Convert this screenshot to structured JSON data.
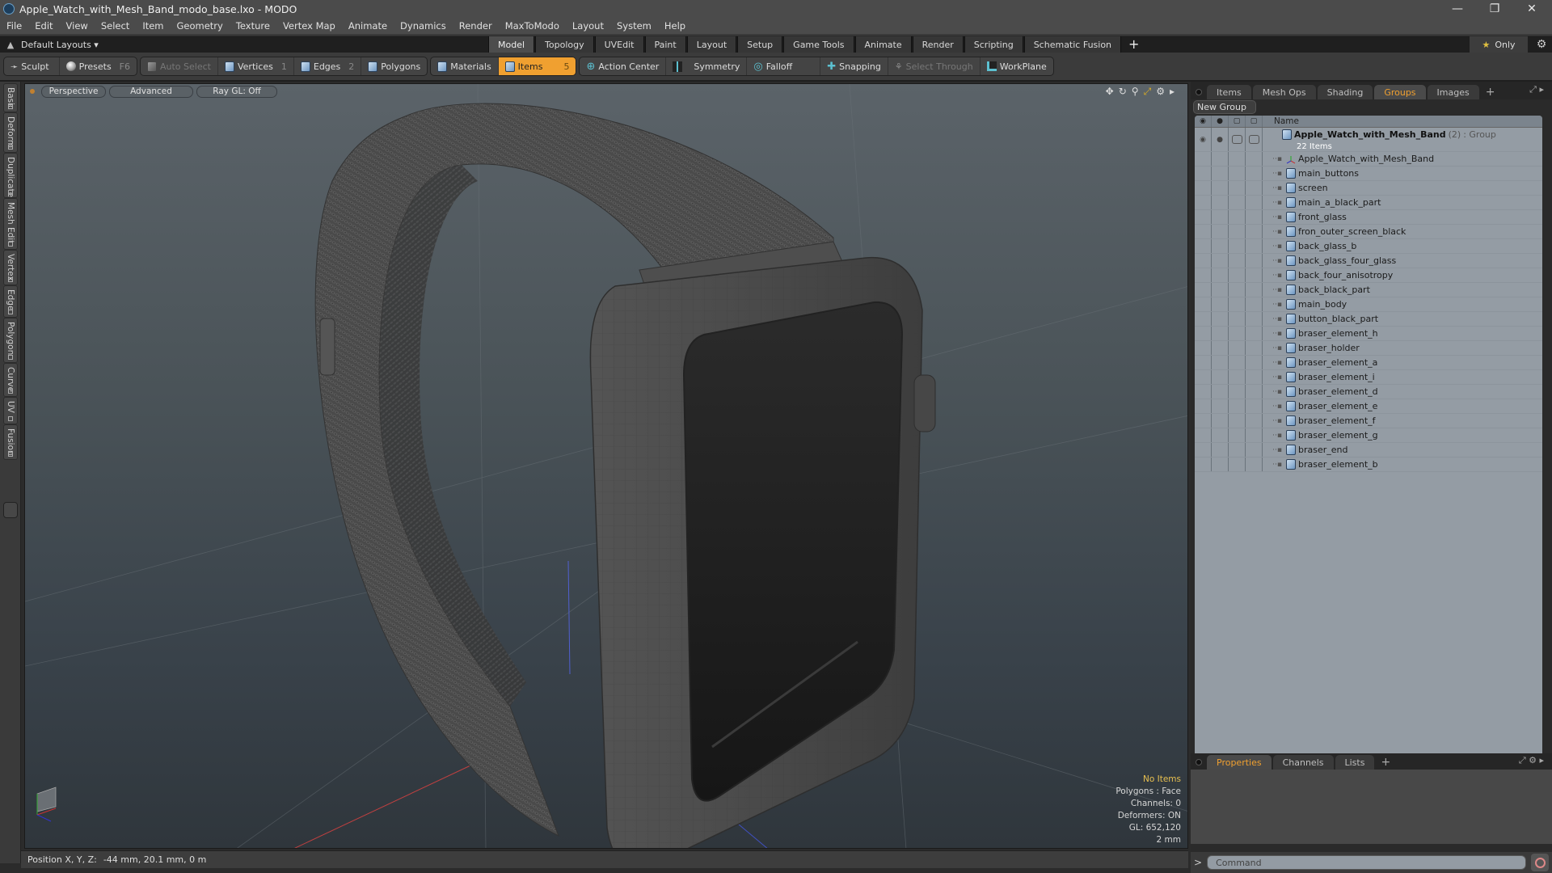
{
  "window": {
    "title": "Apple_Watch_with_Mesh_Band_modo_base.lxo - MODO",
    "controls": [
      "minimize-icon",
      "restore-icon",
      "close-icon"
    ]
  },
  "menu": [
    "File",
    "Edit",
    "View",
    "Select",
    "Item",
    "Geometry",
    "Texture",
    "Vertex Map",
    "Animate",
    "Dynamics",
    "Render",
    "MaxToModo",
    "Layout",
    "System",
    "Help"
  ],
  "layout_bar": {
    "layouts_label": "Default Layouts ▾",
    "tabs": [
      "Model",
      "Topology",
      "UVEdit",
      "Paint",
      "Layout",
      "Setup",
      "Game Tools",
      "Animate",
      "Render",
      "Scripting",
      "Schematic Fusion"
    ],
    "active_tab": "Model",
    "only_label": "Only"
  },
  "toolbar": {
    "sculpt": "Sculpt",
    "presets": "Presets",
    "presets_key": "F6",
    "auto_select": "Auto Select",
    "vertices": "Vertices",
    "vertices_key": "1",
    "edges": "Edges",
    "edges_key": "2",
    "polygons": "Polygons",
    "materials": "Materials",
    "items": "Items",
    "items_key": "5",
    "action_center": "Action Center",
    "symmetry": "Symmetry",
    "falloff": "Falloff",
    "snapping": "Snapping",
    "select_through": "Select Through",
    "workplane": "WorkPlane"
  },
  "side_tabs": [
    "Basic",
    "Deform",
    "Duplicate",
    "Mesh Edit",
    "Vertex",
    "Edge",
    "Polygon",
    "Curve",
    "UV",
    "Fusion"
  ],
  "viewport": {
    "view_mode": "Perspective",
    "shading": "Advanced",
    "raygl": "Ray GL: Off",
    "stats": {
      "selection": "No Items",
      "polygons": "Polygons : Face",
      "channels": "Channels: 0",
      "deformers": "Deformers: ON",
      "gl": "GL: 652,120",
      "grid": "2 mm"
    }
  },
  "status": {
    "position_label": "Position X, Y, Z:",
    "position_value": "-44 mm, 20.1 mm, 0 m"
  },
  "right_panel": {
    "tabs": [
      "Items",
      "Mesh Ops",
      "Shading",
      "Groups",
      "Images"
    ],
    "active_tab": "Groups",
    "new_group": "New Group",
    "name_header": "Name",
    "group": {
      "name": "Apple_Watch_with_Mesh_Band",
      "count_suffix": "(2)",
      "type": ": Group",
      "items_count": "22 Items"
    },
    "items": [
      {
        "name": "Apple_Watch_with_Mesh_Band",
        "icon": "locator-icon"
      },
      {
        "name": "main_buttons",
        "icon": "mesh-icon"
      },
      {
        "name": "screen",
        "icon": "mesh-icon"
      },
      {
        "name": "main_a_black_part",
        "icon": "mesh-icon"
      },
      {
        "name": "front_glass",
        "icon": "mesh-icon"
      },
      {
        "name": "fron_outer_screen_black",
        "icon": "mesh-icon"
      },
      {
        "name": "back_glass_b",
        "icon": "mesh-icon"
      },
      {
        "name": "back_glass_four_glass",
        "icon": "mesh-icon"
      },
      {
        "name": "back_four_anisotropy",
        "icon": "mesh-icon"
      },
      {
        "name": "back_black_part",
        "icon": "mesh-icon"
      },
      {
        "name": "main_body",
        "icon": "mesh-icon"
      },
      {
        "name": "button_black_part",
        "icon": "mesh-icon"
      },
      {
        "name": "braser_element_h",
        "icon": "mesh-icon"
      },
      {
        "name": "braser_holder",
        "icon": "mesh-icon"
      },
      {
        "name": "braser_element_a",
        "icon": "mesh-icon"
      },
      {
        "name": "braser_element_i",
        "icon": "mesh-icon"
      },
      {
        "name": "braser_element_d",
        "icon": "mesh-icon"
      },
      {
        "name": "braser_element_e",
        "icon": "mesh-icon"
      },
      {
        "name": "braser_element_f",
        "icon": "mesh-icon"
      },
      {
        "name": "braser_element_g",
        "icon": "mesh-icon"
      },
      {
        "name": "braser_end",
        "icon": "mesh-icon"
      },
      {
        "name": "braser_element_b",
        "icon": "mesh-icon"
      }
    ],
    "bottom_tabs": [
      "Properties",
      "Channels",
      "Lists"
    ],
    "bottom_active": "Properties",
    "command_placeholder": "Command"
  },
  "colors": {
    "accent": "#f0a030",
    "panel_list_bg": "#949ca4",
    "stats_highlight": "#e8c050"
  }
}
